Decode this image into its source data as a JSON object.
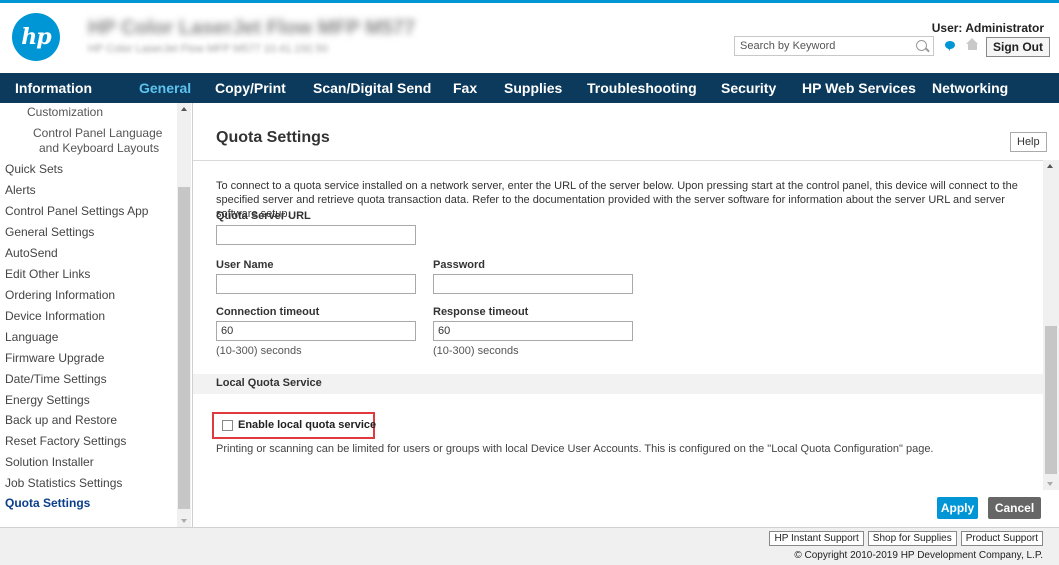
{
  "header": {
    "logo_text": "hp",
    "device_name": "HP Color LaserJet Flow MFP M577",
    "device_subtitle": "HP Color LaserJet Flow MFP M577    10.41.192.50",
    "search_placeholder": "Search by Keyword",
    "user_label": "User: Administrator",
    "sign_out": "Sign Out"
  },
  "nav": {
    "tabs": [
      "Information",
      "General",
      "Copy/Print",
      "Scan/Digital Send",
      "Fax",
      "Supplies",
      "Troubleshooting",
      "Security",
      "HP Web Services",
      "Networking"
    ],
    "active": "General"
  },
  "sidebar": {
    "items": [
      {
        "label": "Customization"
      },
      {
        "label": "Control Panel Language"
      },
      {
        "label": "and Keyboard Layouts"
      },
      {
        "label": "Quick Sets"
      },
      {
        "label": "Alerts"
      },
      {
        "label": "Control Panel Settings App"
      },
      {
        "label": "General Settings"
      },
      {
        "label": "AutoSend"
      },
      {
        "label": "Edit Other Links"
      },
      {
        "label": "Ordering Information"
      },
      {
        "label": "Device Information"
      },
      {
        "label": "Language"
      },
      {
        "label": "Firmware Upgrade"
      },
      {
        "label": "Date/Time Settings"
      },
      {
        "label": "Energy Settings"
      },
      {
        "label": "Back up and Restore"
      },
      {
        "label": "Reset Factory Settings"
      },
      {
        "label": "Solution Installer"
      },
      {
        "label": "Job Statistics Settings"
      },
      {
        "label": "Quota Settings"
      }
    ]
  },
  "main": {
    "title": "Quota Settings",
    "help": "Help",
    "description": "To connect to a quota service installed on a network server, enter the URL of the server below. Upon pressing start at the control panel, this device will connect to the specified server and retrieve quota transaction data. Refer to the documentation provided with the server software for information about the server URL and server software setup.",
    "quota_server_url": {
      "label": "Quota Server URL",
      "value": ""
    },
    "user_name": {
      "label": "User Name",
      "value": ""
    },
    "password": {
      "label": "Password",
      "value": ""
    },
    "connection_timeout": {
      "label": "Connection timeout",
      "value": "60",
      "hint": "(10-300) seconds"
    },
    "response_timeout": {
      "label": "Response timeout",
      "value": "60",
      "hint": "(10-300) seconds"
    },
    "local_section_title": "Local Quota Service",
    "enable_local": {
      "label": "Enable local quota service",
      "checked": false
    },
    "local_note": "Printing or scanning can be limited for users or groups with local Device User Accounts. This is configured on the \"Local Quota Configuration\" page.",
    "apply": "Apply",
    "cancel": "Cancel"
  },
  "footer": {
    "links": [
      "HP Instant Support",
      "Shop for Supplies",
      "Product Support"
    ],
    "copyright": "© Copyright 2010-2019 HP Development Company, L.P."
  },
  "colors": {
    "accent_blue": "#0096d6",
    "nav_background": "#0c3a5c",
    "highlight_red": "#e0393e"
  }
}
